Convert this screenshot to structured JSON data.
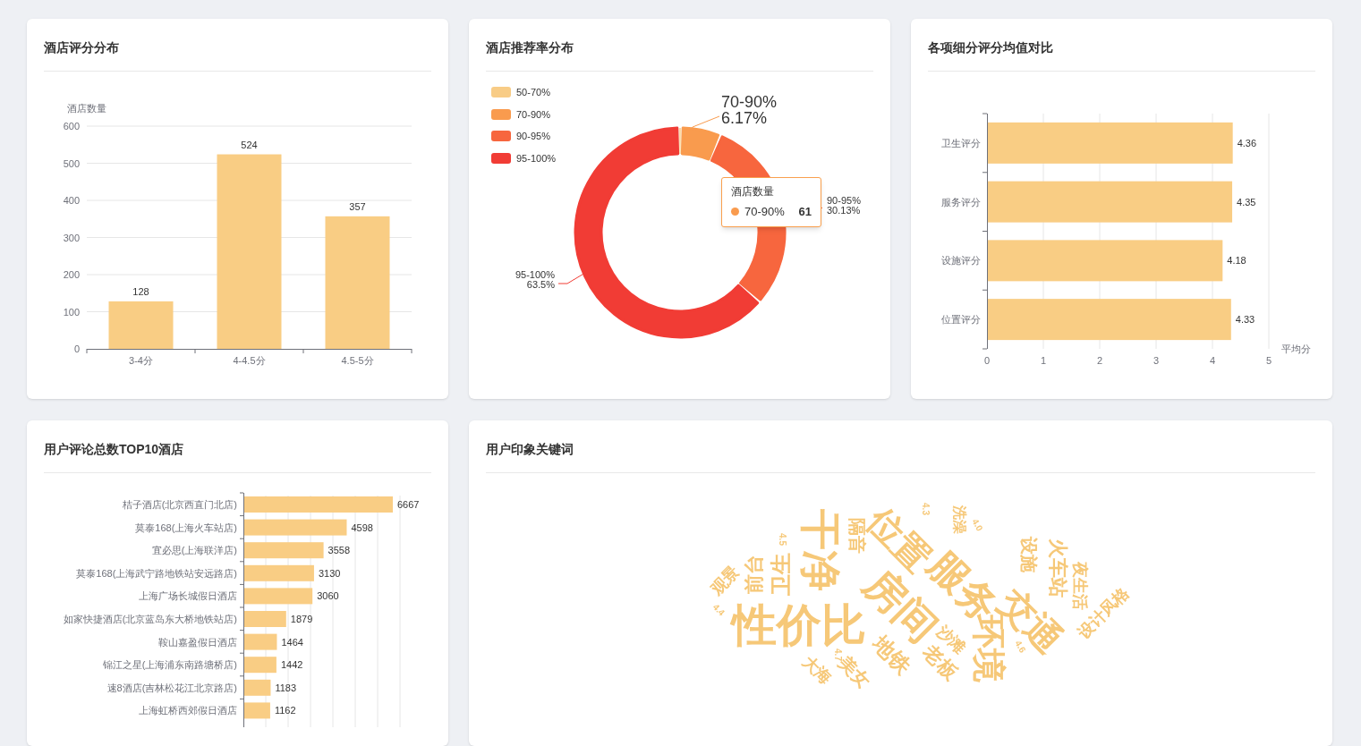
{
  "cards": [
    {
      "kind": "bar",
      "title": "酒店评分分布",
      "chart_data": {
        "type": "bar",
        "ylabel": "酒店数量",
        "categories": [
          "3-4分",
          "4-4.5分",
          "4.5-5分"
        ],
        "series": [
          {
            "color": "#f9cd84",
            "values": [
              128,
              524,
              357
            ]
          }
        ],
        "ylim": [
          0,
          600
        ],
        "yticks": [
          0,
          100,
          200,
          300,
          400,
          500,
          600
        ],
        "grid": true,
        "data_labels": true
      }
    },
    {
      "kind": "donut",
      "title": "酒店推荐率分布",
      "legend": [
        {
          "color": "#f8cc86"
        },
        {
          "color": "#f99b4e"
        },
        {
          "color": "#f7663e"
        },
        {
          "color": "#f13c35"
        }
      ],
      "tooltip": {
        "title": "酒店数量",
        "name": "70-90%",
        "value": "61",
        "color": "#f99b4e"
      },
      "chart_data": {
        "type": "donut",
        "categories": [
          "50-70%",
          "70-90%",
          "90-95%",
          "95-100%"
        ],
        "series": [
          {
            "values": [
              0.2,
              6.17,
              30.13,
              63.5
            ]
          }
        ],
        "value_labels": [
          null,
          "6.17%",
          "30.13%",
          "63.5%"
        ]
      }
    },
    {
      "kind": "hbar",
      "title": "各项细分评分均值对比",
      "chart_data": {
        "type": "bar",
        "orientation": "horizontal",
        "xlabel": "平均分",
        "categories": [
          "卫生评分",
          "服务评分",
          "设施评分",
          "位置评分"
        ],
        "series": [
          {
            "color": "#f9cd84",
            "values": [
              4.36,
              4.35,
              4.18,
              4.33
            ]
          }
        ],
        "xlim": [
          0,
          5
        ],
        "xticks": [
          0,
          1,
          2,
          3,
          4,
          5
        ],
        "grid": true,
        "data_labels": true
      }
    },
    {
      "kind": "ranking",
      "title": "用户评论总数TOP10酒店",
      "chart_data": {
        "type": "bar",
        "orientation": "horizontal",
        "categories": [
          "桔子酒店(北京西直门北店)",
          "莫泰168(上海火车站店)",
          "宜必思(上海联洋店)",
          "莫泰168(上海武宁路地铁站安远路店)",
          "上海广场长城假日酒店",
          "如家快捷酒店(北京蓝岛东大桥地铁站店)",
          "鞍山嘉盈假日酒店",
          "锦江之星(上海浦东南路塘桥店)",
          "速8酒店(吉林松花江北京路店)",
          "上海虹桥西郊假日酒店"
        ],
        "series": [
          {
            "color": "#f9cd84",
            "values": [
              6667,
              4598,
              3558,
              3130,
              3060,
              1879,
              1464,
              1442,
              1183,
              1162
            ]
          }
        ],
        "grid": true,
        "data_labels": true
      }
    },
    {
      "kind": "wordcloud",
      "title": "用户印象关键词",
      "color": "#f6c878",
      "words": [
        "性价比",
        "房间",
        "服务",
        "位置",
        "干净",
        "交通",
        "环境",
        "卫生",
        "前台",
        "观景",
        "隔音",
        "洗澡",
        "设施",
        "火车站",
        "夜生活",
        "设计风格",
        "沙滩",
        "老板",
        "地铁",
        "美女",
        "大海",
        "4.5",
        "4.3",
        "4.0",
        "4.4",
        "4.6",
        "4.7"
      ]
    }
  ]
}
